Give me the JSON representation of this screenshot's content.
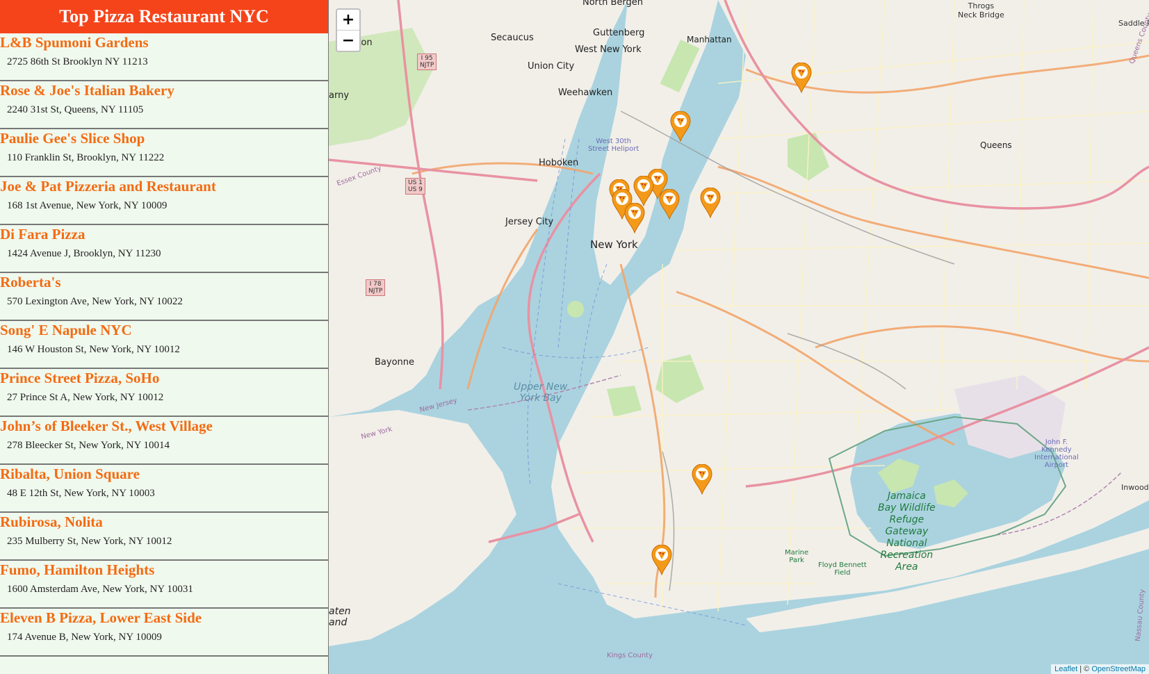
{
  "sidebar": {
    "title": "Top Pizza Restaurant NYC",
    "restaurants": [
      {
        "name": "L&B Spumoni Gardens",
        "address": "2725 86th St Brooklyn NY 11213"
      },
      {
        "name": "Rose & Joe's Italian Bakery",
        "address": "2240 31st St, Queens, NY 11105"
      },
      {
        "name": "Paulie Gee's Slice Shop",
        "address": "110 Franklin St, Brooklyn, NY 11222"
      },
      {
        "name": "Joe & Pat Pizzeria and Restaurant",
        "address": "168 1st Avenue, New York, NY 10009"
      },
      {
        "name": "Di Fara Pizza",
        "address": "1424 Avenue J, Brooklyn, NY 11230"
      },
      {
        "name": "Roberta's",
        "address": "570 Lexington Ave, New York, NY 10022"
      },
      {
        "name": "Song' E Napule NYC",
        "address": "146 W Houston St, New York, NY 10012"
      },
      {
        "name": "Prince Street Pizza, SoHo",
        "address": "27 Prince St A, New York, NY 10012"
      },
      {
        "name": "John’s of Bleeker St., West Village",
        "address": "278 Bleecker St, New York, NY 10014"
      },
      {
        "name": "Ribalta, Union Square",
        "address": "48 E 12th St, New York, NY 10003"
      },
      {
        "name": "Rubirosa, Nolita",
        "address": "235 Mulberry St, New York, NY 10012"
      },
      {
        "name": "Fumo, Hamilton Heights",
        "address": "1600 Amsterdam Ave, New York, NY 10031"
      },
      {
        "name": "Eleven B Pizza, Lower East Side",
        "address": "174 Avenue B, New York, NY 10009"
      }
    ]
  },
  "map": {
    "zoom_in_label": "+",
    "zoom_out_label": "−",
    "attribution_leaflet": "Leaflet",
    "attribution_sep": " | © ",
    "attribution_osm": "OpenStreetMap",
    "labels": {
      "north_bergen": "North Bergen",
      "guttenberg": "Guttenberg",
      "manhattan": "Manhattan",
      "throgs_neck": "Throgs\nNeck Bridge",
      "secaucus": "Secaucus",
      "west_new_york": "West New York",
      "union_city": "Union City",
      "weehawken": "Weehawken",
      "hoboken": "Hoboken",
      "jersey_city": "Jersey City",
      "new_york": "New York",
      "queens": "Queens",
      "bayonne": "Bayonne",
      "upper_ny_bay": "Upper New\nYork Bay",
      "jamaica_bay": "Jamaica\nBay Wildlife\nRefuge\nGateway\nNational\nRecreation\nArea",
      "jfk": "John F.\nKennedy\nInternational\nAirport",
      "floyd_bennett": "Floyd Bennett\nField",
      "marine_park": "Marine\nPark",
      "west_30th": "West 30th\nStreet Heliport",
      "inwood": "Inwood",
      "saddle_rock": "Saddle Roc",
      "kings_county": "Kings County",
      "queens_county": "Queens County",
      "nassau_county": "Nassau County",
      "new_jersey": "New Jersey",
      "new_york_state": "New York",
      "essex_county": "Essex County",
      "staten_island": "aten\nand",
      "lyndhurst": "llington",
      "kearny": "arny"
    },
    "shields": {
      "i95": "I 95\nNJTP",
      "us1": "US 1\nUS 9",
      "i78": "I 78\nNJTP"
    },
    "marker_icon": "pizza-marker-icon"
  }
}
